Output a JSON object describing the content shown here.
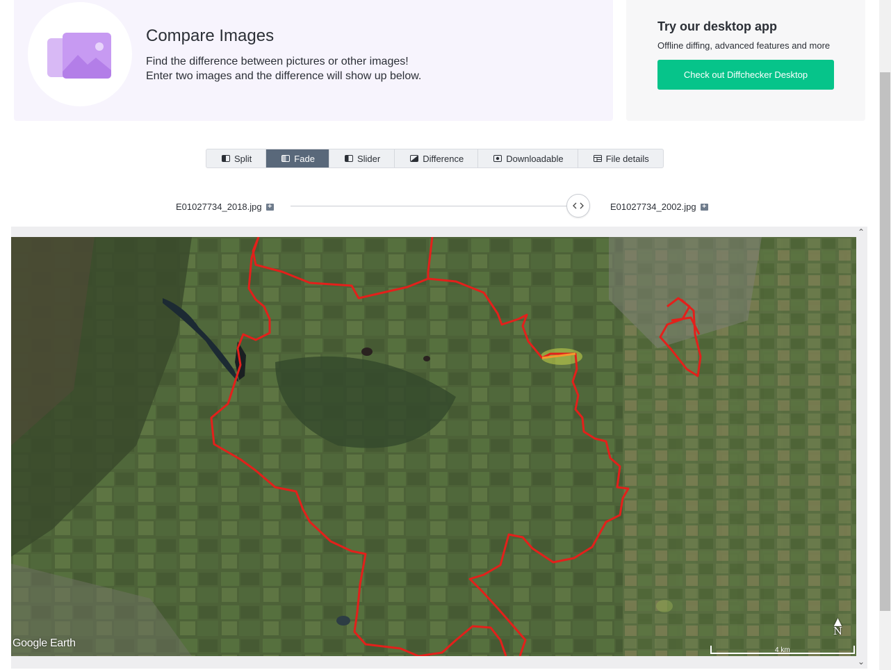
{
  "hero": {
    "title": "Compare Images",
    "description_line1": "Find the difference between pictures or other images!",
    "description_line2": "Enter two images and the difference will show up below.",
    "illustration_icon": "image-stack-icon"
  },
  "promo": {
    "title": "Try our desktop app",
    "subtitle": "Offline diffing, advanced features and more",
    "button_label": "Check out Diffchecker Desktop",
    "button_color": "#06c48a"
  },
  "tabs": [
    {
      "label": "Split",
      "icon": "split-icon",
      "active": false
    },
    {
      "label": "Fade",
      "icon": "fade-icon",
      "active": true
    },
    {
      "label": "Slider",
      "icon": "slider-icon",
      "active": false
    },
    {
      "label": "Difference",
      "icon": "difference-icon",
      "active": false
    },
    {
      "label": "Downloadable",
      "icon": "download-icon",
      "active": false
    },
    {
      "label": "File details",
      "icon": "file-details-icon",
      "active": false
    }
  ],
  "fade": {
    "left_file": "E01027734_2018.jpg",
    "right_file": "E01027734_2002.jpg",
    "slider_value": 1.0
  },
  "map": {
    "brand": "Google Earth",
    "north_label": "N",
    "scale_label": "4 km",
    "boundary_color": "#e3201b"
  }
}
